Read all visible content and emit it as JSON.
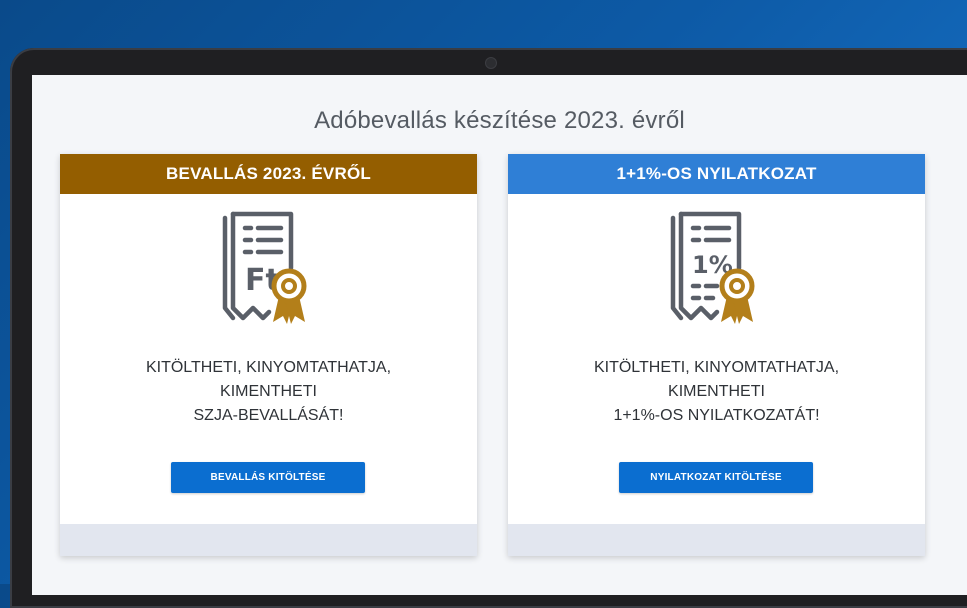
{
  "page": {
    "title": "Adóbevallás készítése 2023. évről"
  },
  "cards": [
    {
      "header": "BEVALLÁS 2023. ÉVRŐL",
      "icon": "tax-document-ft-icon",
      "icon_text": "Ft",
      "lines": [
        "KITÖLTHETI, KINYOMTATHATJA,",
        "KIMENTHETI",
        "SZJA-BEVALLÁSÁT!"
      ],
      "button_label": "BEVALLÁS KITÖLTÉSE",
      "header_color": "#945e00"
    },
    {
      "header": "1+1%-OS NYILATKOZAT",
      "icon": "tax-document-percent-icon",
      "icon_text": "1%",
      "lines": [
        "KITÖLTHETI, KINYOMTATHATJA,",
        "KIMENTHETI",
        "1+1%-OS NYILATKOZATÁT!"
      ],
      "button_label": "NYILATKOZAT KITÖLTÉSE",
      "header_color": "#2f7fd6"
    }
  ],
  "colors": {
    "accent_blue": "#0b6ed0",
    "icon_gray": "#5a5f68",
    "medal_gold": "#b37f1a"
  }
}
